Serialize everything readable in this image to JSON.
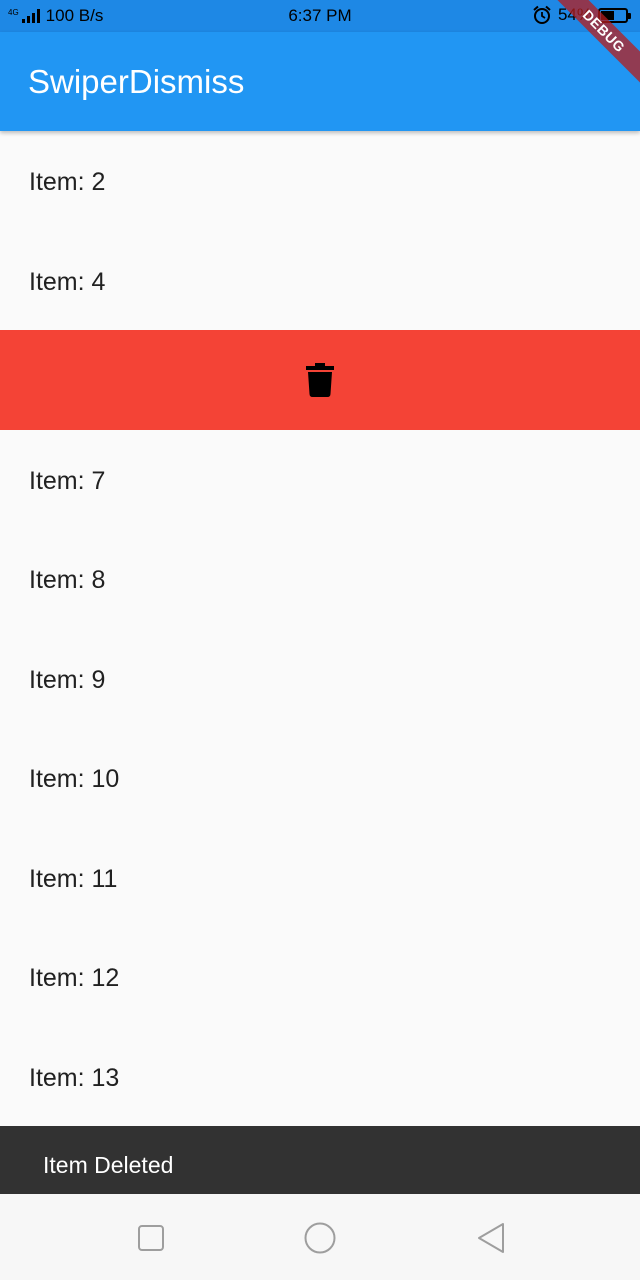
{
  "status_bar": {
    "network_type": "4G",
    "data_rate": "100 B/s",
    "time": "6:37 PM",
    "battery": "54%",
    "battery_level": 0.54
  },
  "debug_banner": "DEBUG",
  "app_bar": {
    "title": "SwiperDismiss",
    "color": "#2196f3"
  },
  "list": {
    "items_before": [
      "Item: 2",
      "Item: 4"
    ],
    "dismiss_background": {
      "color": "#f44336",
      "icon": "delete-icon"
    },
    "items_after": [
      "Item: 7",
      "Item: 8",
      "Item: 9",
      "Item: 10",
      "Item: 11",
      "Item: 12",
      "Item: 13"
    ]
  },
  "snackbar": {
    "message": "Item Deleted"
  },
  "nav_bar": {
    "buttons": [
      "recent-apps-icon",
      "home-icon",
      "back-icon"
    ]
  }
}
